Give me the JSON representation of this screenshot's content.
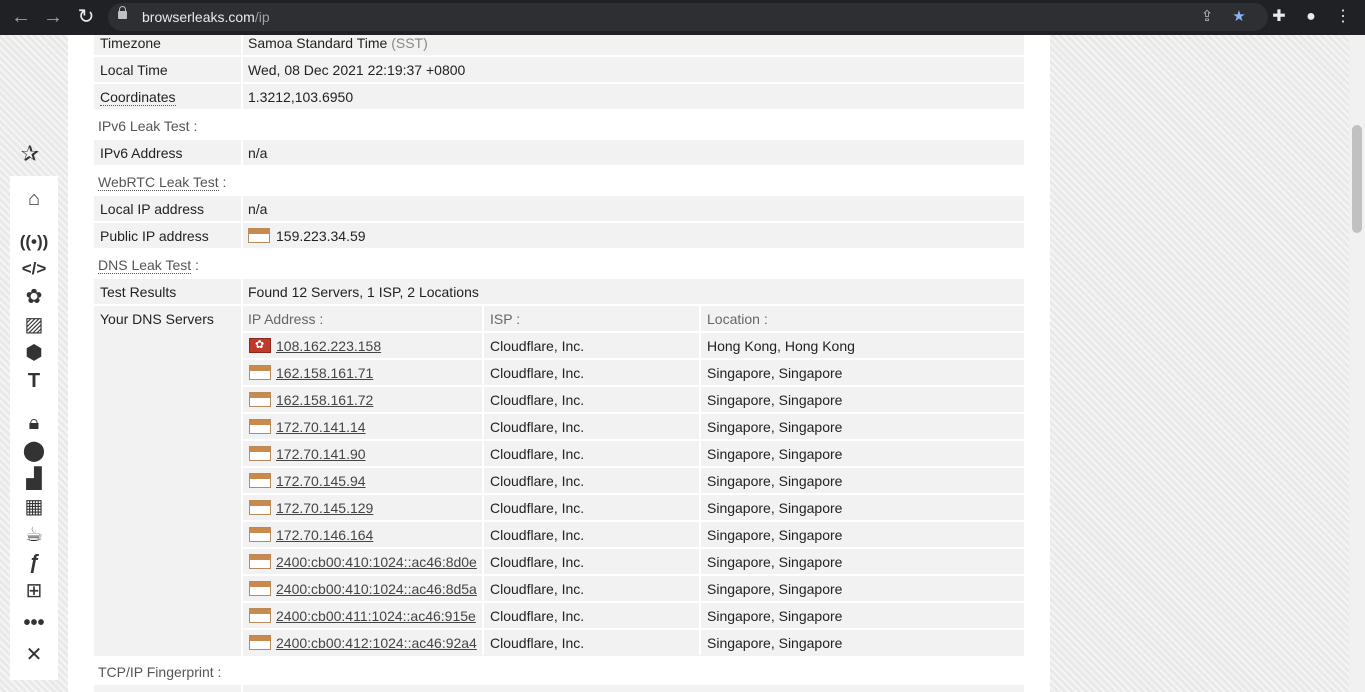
{
  "browser": {
    "url_host": "browserleaks.com",
    "url_path": "/ip"
  },
  "rows_top": [
    {
      "label": "Timezone",
      "value": "Samoa Standard Time",
      "extra": "(SST)"
    },
    {
      "label": "Local Time",
      "value": "Wed, 08 Dec 2021 22:19:37 +0800"
    },
    {
      "label": "Coordinates",
      "value": "1.3212,103.6950"
    }
  ],
  "ipv6": {
    "section": "IPv6 Leak Test :",
    "label": "IPv6 Address",
    "value": "n/a"
  },
  "webrtc": {
    "section": "WebRTC Leak Test",
    "colon": ":",
    "local_label": "Local IP address",
    "local_value": "n/a",
    "public_label": "Public IP address",
    "public_value": "159.223.34.59"
  },
  "dns": {
    "section": "DNS Leak Test",
    "colon": ":",
    "test_label": "Test Results",
    "test_value": "Found 12 Servers, 1 ISP, 2 Locations",
    "servers_label": "Your DNS Servers",
    "headers": [
      "IP Address :",
      "ISP :",
      "Location :"
    ],
    "servers": [
      {
        "ip": "108.162.223.158",
        "isp": "Cloudflare, Inc.",
        "location": "Hong Kong, Hong Kong",
        "flag": "hk"
      },
      {
        "ip": "162.158.161.71",
        "isp": "Cloudflare, Inc.",
        "location": "Singapore, Singapore",
        "flag": "sg"
      },
      {
        "ip": "162.158.161.72",
        "isp": "Cloudflare, Inc.",
        "location": "Singapore, Singapore",
        "flag": "sg"
      },
      {
        "ip": "172.70.141.14",
        "isp": "Cloudflare, Inc.",
        "location": "Singapore, Singapore",
        "flag": "sg"
      },
      {
        "ip": "172.70.141.90",
        "isp": "Cloudflare, Inc.",
        "location": "Singapore, Singapore",
        "flag": "sg"
      },
      {
        "ip": "172.70.145.94",
        "isp": "Cloudflare, Inc.",
        "location": "Singapore, Singapore",
        "flag": "sg"
      },
      {
        "ip": "172.70.145.129",
        "isp": "Cloudflare, Inc.",
        "location": "Singapore, Singapore",
        "flag": "sg"
      },
      {
        "ip": "172.70.146.164",
        "isp": "Cloudflare, Inc.",
        "location": "Singapore, Singapore",
        "flag": "sg"
      },
      {
        "ip": "2400:cb00:410:1024::ac46:8d0e",
        "isp": "Cloudflare, Inc.",
        "location": "Singapore, Singapore",
        "flag": "sg"
      },
      {
        "ip": "2400:cb00:410:1024::ac46:8d5a",
        "isp": "Cloudflare, Inc.",
        "location": "Singapore, Singapore",
        "flag": "sg"
      },
      {
        "ip": "2400:cb00:411:1024::ac46:915e",
        "isp": "Cloudflare, Inc.",
        "location": "Singapore, Singapore",
        "flag": "sg"
      },
      {
        "ip": "2400:cb00:412:1024::ac46:92a4",
        "isp": "Cloudflare, Inc.",
        "location": "Singapore, Singapore",
        "flag": "sg"
      }
    ]
  },
  "tcpip": {
    "section": "TCP/IP Fingerprint :"
  },
  "icons": {
    "sidebar": [
      "home-icon",
      "broadcast-icon",
      "code-icon",
      "puzzle-icon",
      "image-icon",
      "cube-icon",
      "text-height-icon",
      "lock-icon",
      "map-marker-icon",
      "signal-icon",
      "wall-icon",
      "coffee-icon",
      "flash-icon",
      "windows-icon",
      "more-icon",
      "tools-icon"
    ]
  }
}
